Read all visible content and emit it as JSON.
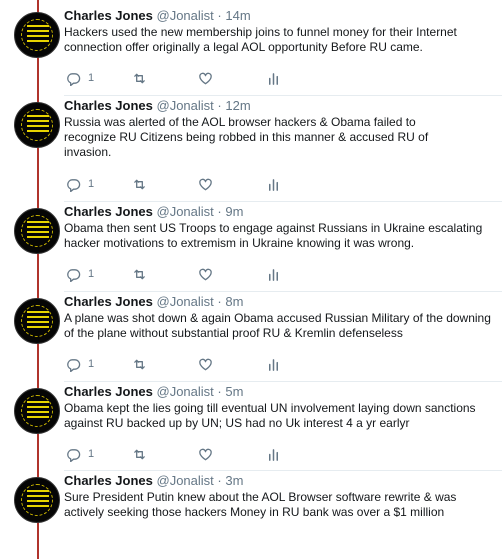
{
  "tweets": [
    {
      "name": "Charles Jones",
      "handle": "@Jonalist",
      "dot": "·",
      "time": "14m",
      "text": "Hackers used the new membership joins to funnel money for their Internet connection offer originally a legal AOL opportunity Before RU came.",
      "reply_count": "1"
    },
    {
      "name": "Charles Jones",
      "handle": "@Jonalist",
      "dot": "·",
      "time": "12m",
      "text": "Russia was alerted of the AOL browser hackers & Obama failed to recognize RU Citizens being robbed in this manner & accused RU of invasion.",
      "reply_count": "1"
    },
    {
      "name": "Charles Jones",
      "handle": "@Jonalist",
      "dot": "·",
      "time": "9m",
      "text": "Obama then sent US Troops to engage against Russians in Ukraine escalating hacker motivations to extremism in Ukraine knowing it was wrong.",
      "reply_count": "1"
    },
    {
      "name": "Charles Jones",
      "handle": "@Jonalist",
      "dot": "·",
      "time": "8m",
      "text": "A plane was shot down & again Obama accused Russian Military of the downing of the plane without substantial proof RU & Kremlin defenseless",
      "reply_count": "1"
    },
    {
      "name": "Charles Jones",
      "handle": "@Jonalist",
      "dot": "·",
      "time": "5m",
      "text": "Obama kept the lies going till eventual UN involvement laying down sanctions against RU backed up by UN; US had no Uk interest 4 a yr earlyr",
      "reply_count": "1"
    },
    {
      "name": "Charles Jones",
      "handle": "@Jonalist",
      "dot": "·",
      "time": "3m",
      "text": "Sure President Putin knew about the AOL Browser software rewrite & was actively seeking those hackers Money in RU bank was over a $1 million",
      "reply_count": ""
    }
  ],
  "icons": {
    "reply": "reply-icon",
    "retweet": "retweet-icon",
    "like": "heart-icon",
    "analytics": "analytics-icon"
  },
  "colors": {
    "thread_line": "#b0342c",
    "action_gray": "#657786",
    "avatar_bg": "#050505",
    "avatar_accent": "#e8d400"
  }
}
